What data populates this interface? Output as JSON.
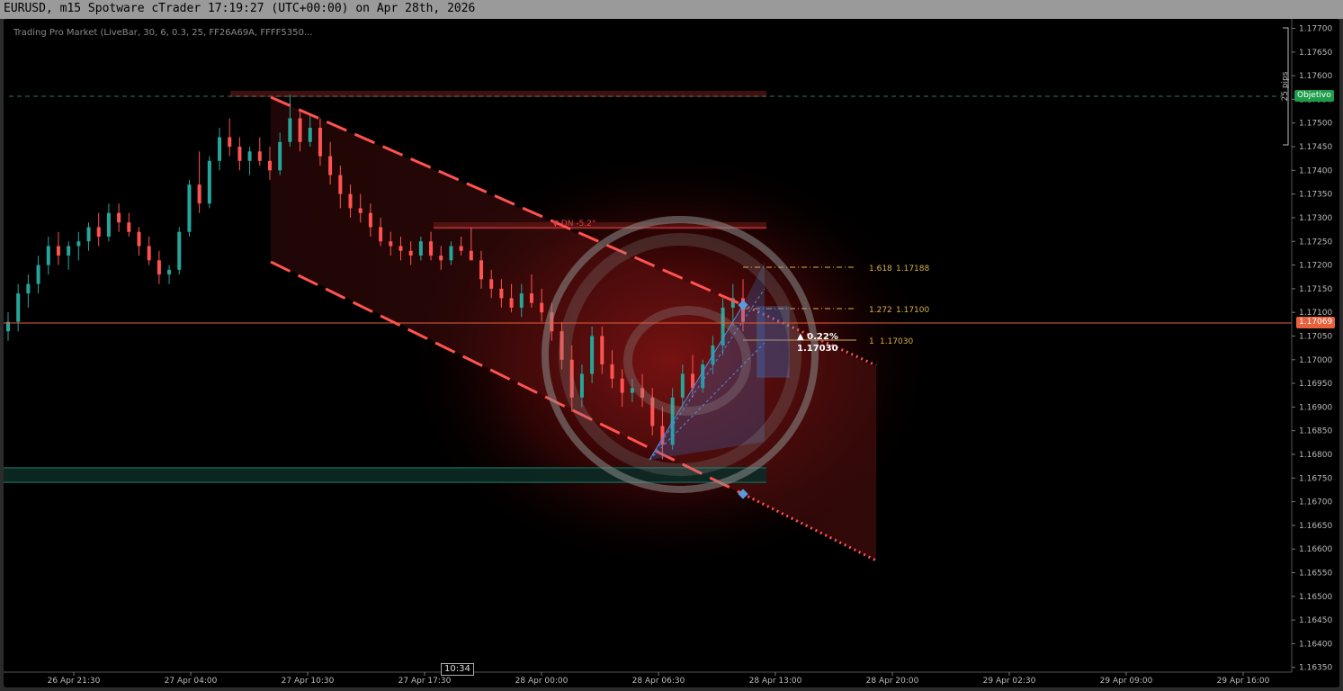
{
  "window": {
    "title": "EURUSD, m15 Spotware cTrader 17:19:27 (UTC+00:00) on Apr 28th, 2026"
  },
  "chart": {
    "indicator_label": "Trading Pro Market (LiveBar, 30, 6, 0.3, 25, FF26A69A, FFFF5350...",
    "current_price_tag": "1.17069",
    "objective_tag": "Objetivo",
    "pips_label": "25 pips",
    "cursor_time": "10:34",
    "channel_label": "▼ DN -5.2°",
    "target_box": {
      "change": "▲ 0.22%",
      "price": "1.17030"
    },
    "fib_levels": [
      {
        "ratio": "1.618",
        "price": "1.17188"
      },
      {
        "ratio": "1.272",
        "price": "1.17100"
      },
      {
        "ratio": "1",
        "price": "1.17030"
      }
    ],
    "colors": {
      "bull": "#26a69a",
      "bear": "#ff5350",
      "channel": "#ff5350",
      "current_price": "#e8603c",
      "fib": "#d9b04a",
      "projection": "#3a7bd5"
    }
  },
  "chart_data": {
    "type": "candlestick",
    "symbol": "EURUSD",
    "timeframe": "m15",
    "price_axis": {
      "ticks": [
        "1.17700",
        "1.17650",
        "1.17600",
        "1.17550",
        "1.17500",
        "1.17450",
        "1.17400",
        "1.17350",
        "1.17300",
        "1.17250",
        "1.17200",
        "1.17150",
        "1.17100",
        "1.17050",
        "1.17000",
        "1.16950",
        "1.16900",
        "1.16850",
        "1.16800",
        "1.16750",
        "1.16700",
        "1.16650",
        "1.16600",
        "1.16550",
        "1.16500",
        "1.16450",
        "1.16400",
        "1.16350"
      ],
      "range": [
        1.1634,
        1.1772
      ]
    },
    "time_axis": {
      "ticks": [
        "26 Apr 21:30",
        "27 Apr 04:00",
        "27 Apr 10:30",
        "27 Apr 17:30",
        "28 Apr 00:00",
        "28 Apr 06:30",
        "28 Apr 13:00",
        "28 Apr 20:00",
        "29 Apr 02:30",
        "29 Apr 09:00",
        "29 Apr 16:00"
      ]
    },
    "current_price": 1.17069,
    "objective_price": 1.17545,
    "candles": [
      [
        1.1706,
        1.171,
        1.1704,
        1.1708
      ],
      [
        1.1708,
        1.1716,
        1.1706,
        1.1714
      ],
      [
        1.1714,
        1.1718,
        1.1711,
        1.1716
      ],
      [
        1.1716,
        1.1722,
        1.1714,
        1.172
      ],
      [
        1.172,
        1.1726,
        1.1718,
        1.1724
      ],
      [
        1.1724,
        1.1727,
        1.172,
        1.1722
      ],
      [
        1.1722,
        1.1725,
        1.1719,
        1.1724
      ],
      [
        1.1724,
        1.1727,
        1.1721,
        1.1725
      ],
      [
        1.1725,
        1.1729,
        1.1723,
        1.1728
      ],
      [
        1.1728,
        1.1731,
        1.1724,
        1.1726
      ],
      [
        1.1726,
        1.1733,
        1.1725,
        1.1731
      ],
      [
        1.1731,
        1.1733,
        1.1727,
        1.1729
      ],
      [
        1.1729,
        1.1731,
        1.1726,
        1.1727
      ],
      [
        1.1727,
        1.1728,
        1.1722,
        1.1724
      ],
      [
        1.1724,
        1.1726,
        1.172,
        1.1721
      ],
      [
        1.1721,
        1.1723,
        1.1716,
        1.1718
      ],
      [
        1.1718,
        1.172,
        1.1716,
        1.1719
      ],
      [
        1.1719,
        1.1728,
        1.1718,
        1.1727
      ],
      [
        1.1727,
        1.1738,
        1.1726,
        1.1737
      ],
      [
        1.1737,
        1.1744,
        1.1731,
        1.1733
      ],
      [
        1.1733,
        1.1743,
        1.1732,
        1.1742
      ],
      [
        1.1742,
        1.1749,
        1.174,
        1.1747
      ],
      [
        1.1747,
        1.1751,
        1.1743,
        1.1745
      ],
      [
        1.1745,
        1.1747,
        1.174,
        1.1742
      ],
      [
        1.1742,
        1.1745,
        1.1739,
        1.1744
      ],
      [
        1.1744,
        1.1747,
        1.1741,
        1.1742
      ],
      [
        1.1742,
        1.1745,
        1.1738,
        1.174
      ],
      [
        1.174,
        1.1748,
        1.1739,
        1.1746
      ],
      [
        1.1746,
        1.1756,
        1.1745,
        1.1751
      ],
      [
        1.1751,
        1.1753,
        1.1744,
        1.1746
      ],
      [
        1.1746,
        1.1752,
        1.1745,
        1.1749
      ],
      [
        1.1749,
        1.1751,
        1.1741,
        1.1743
      ],
      [
        1.1743,
        1.1746,
        1.1737,
        1.1739
      ],
      [
        1.1739,
        1.1741,
        1.1732,
        1.1735
      ],
      [
        1.1735,
        1.1737,
        1.173,
        1.1732
      ],
      [
        1.1732,
        1.1735,
        1.1729,
        1.1731
      ],
      [
        1.1731,
        1.1733,
        1.1726,
        1.1728
      ],
      [
        1.1728,
        1.173,
        1.1724,
        1.1725
      ],
      [
        1.1725,
        1.1727,
        1.1722,
        1.1724
      ],
      [
        1.1724,
        1.1726,
        1.1721,
        1.1723
      ],
      [
        1.1723,
        1.1725,
        1.172,
        1.1722
      ],
      [
        1.1722,
        1.1726,
        1.1721,
        1.1725
      ],
      [
        1.1725,
        1.1727,
        1.1721,
        1.1722
      ],
      [
        1.1722,
        1.1724,
        1.1719,
        1.1721
      ],
      [
        1.1721,
        1.1725,
        1.172,
        1.1724
      ],
      [
        1.1724,
        1.1726,
        1.1722,
        1.1723
      ],
      [
        1.1723,
        1.1728,
        1.1722,
        1.1721
      ],
      [
        1.1721,
        1.1723,
        1.1715,
        1.1717
      ],
      [
        1.1717,
        1.1719,
        1.1713,
        1.1715
      ],
      [
        1.1715,
        1.1717,
        1.1711,
        1.1713
      ],
      [
        1.1713,
        1.1716,
        1.171,
        1.1711
      ],
      [
        1.1711,
        1.1716,
        1.1709,
        1.1714
      ],
      [
        1.1714,
        1.1718,
        1.1711,
        1.1712
      ],
      [
        1.1712,
        1.1715,
        1.1708,
        1.171
      ],
      [
        1.171,
        1.1712,
        1.1704,
        1.1706
      ],
      [
        1.1706,
        1.1708,
        1.1698,
        1.17
      ],
      [
        1.17,
        1.1703,
        1.1689,
        1.1692
      ],
      [
        1.1692,
        1.1699,
        1.169,
        1.1697
      ],
      [
        1.1697,
        1.1707,
        1.1695,
        1.1705
      ],
      [
        1.1705,
        1.1707,
        1.1697,
        1.1699
      ],
      [
        1.1699,
        1.1702,
        1.1694,
        1.1696
      ],
      [
        1.1696,
        1.1698,
        1.169,
        1.1693
      ],
      [
        1.1693,
        1.1696,
        1.1691,
        1.1694
      ],
      [
        1.1694,
        1.1697,
        1.169,
        1.1692
      ],
      [
        1.1692,
        1.1694,
        1.1684,
        1.1686
      ],
      [
        1.1686,
        1.169,
        1.1679,
        1.1682
      ],
      [
        1.1682,
        1.1694,
        1.1681,
        1.1692
      ],
      [
        1.1692,
        1.1699,
        1.169,
        1.1697
      ],
      [
        1.1697,
        1.1701,
        1.1692,
        1.1694
      ],
      [
        1.1694,
        1.17,
        1.1693,
        1.1699
      ],
      [
        1.1699,
        1.1705,
        1.1697,
        1.1703
      ],
      [
        1.1703,
        1.1713,
        1.1701,
        1.1711
      ],
      [
        1.1711,
        1.1716,
        1.1707,
        1.1713
      ],
      [
        1.1713,
        1.1717,
        1.1706,
        1.1708
      ]
    ]
  }
}
